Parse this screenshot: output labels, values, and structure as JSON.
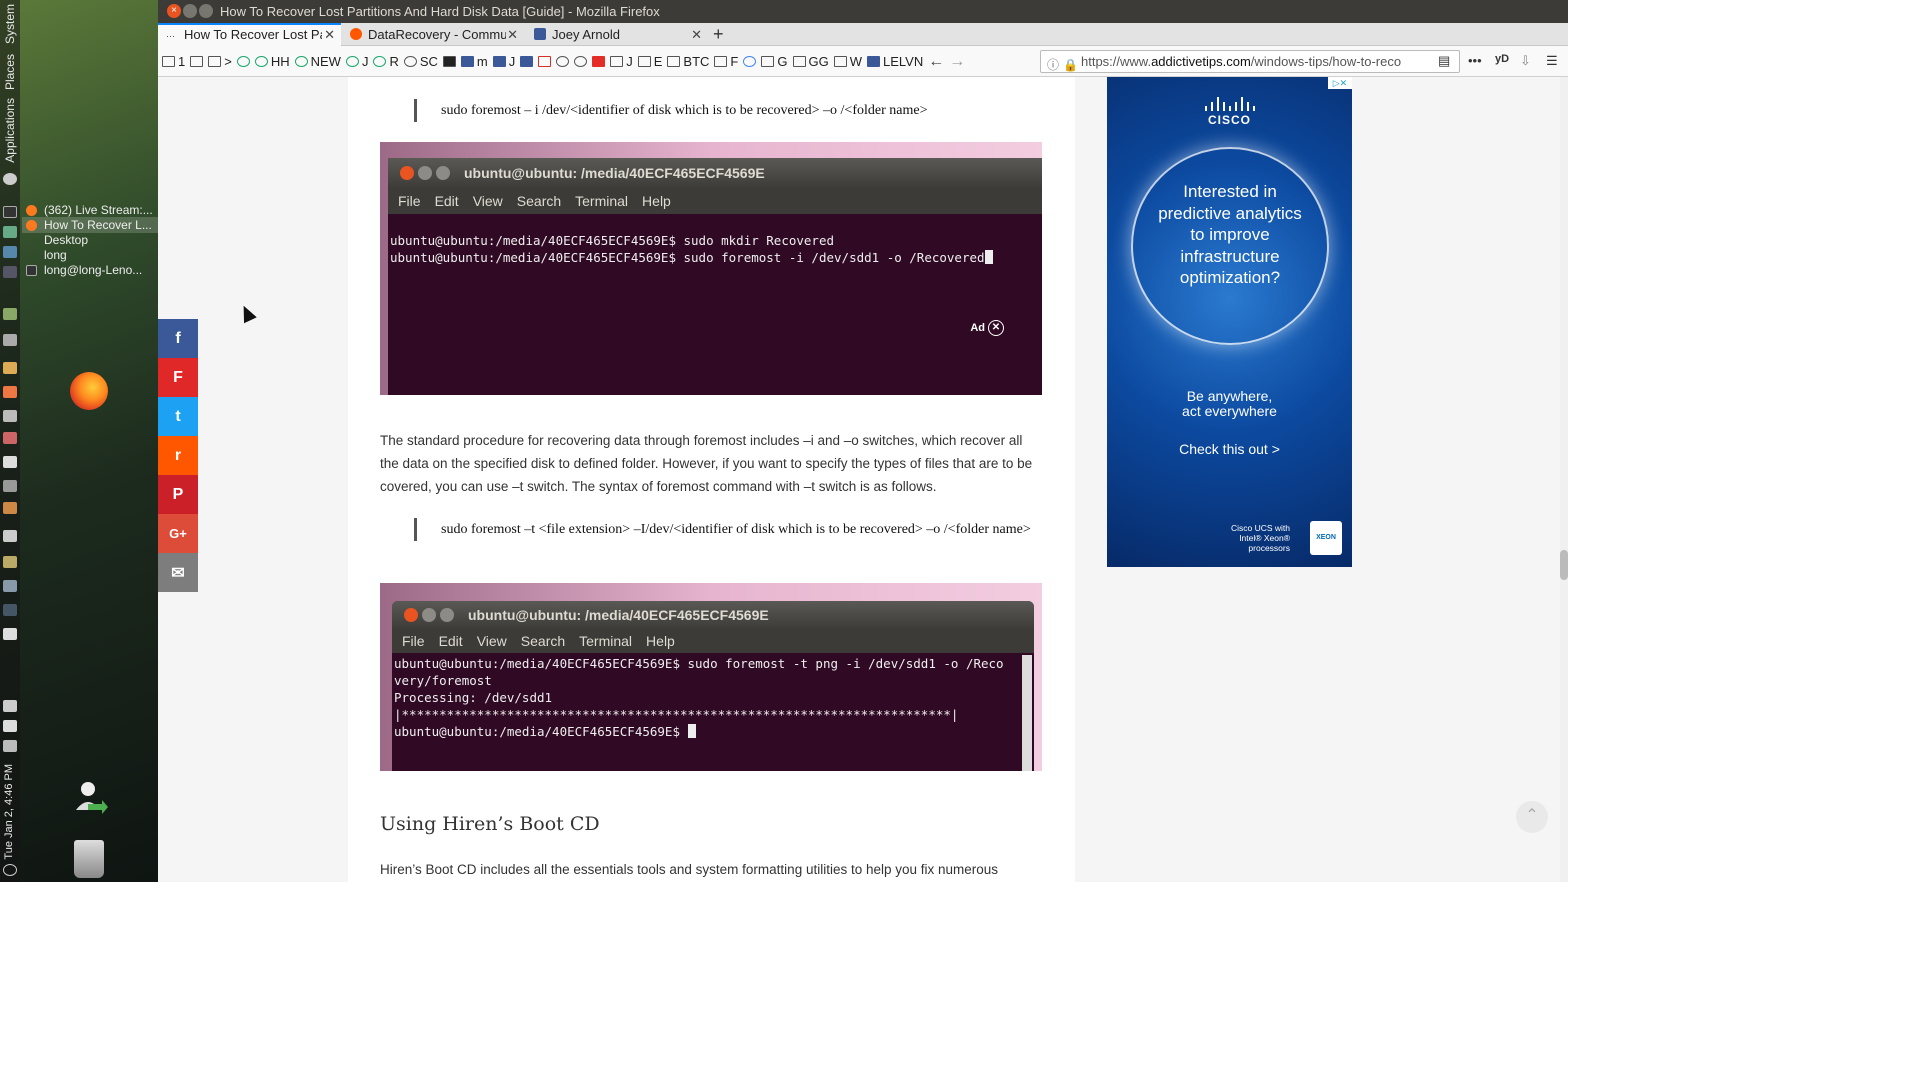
{
  "desktop": {
    "vertical_labels": [
      "System",
      "Places",
      "Applications"
    ],
    "clock": "Tue Jan 2, 4:46 PM",
    "window_list": [
      {
        "label": "(362) Live Stream:...",
        "active": false
      },
      {
        "label": "How To Recover L...",
        "active": true
      },
      {
        "label": "Desktop",
        "active": false
      },
      {
        "label": "long",
        "active": false
      },
      {
        "label": "long@long-Leno...",
        "active": false
      }
    ]
  },
  "browser": {
    "window_title": "How To Recover Lost Partitions And Hard Disk Data [Guide] - Mozilla Firefox",
    "tabs": [
      {
        "label": "How To Recover Lost Pa",
        "active": true
      },
      {
        "label": "DataRecovery - Commun",
        "active": false
      },
      {
        "label": "Joey Arnold",
        "active": false
      }
    ],
    "bookmarks": [
      "1",
      "",
      ">",
      "",
      "HH",
      "NEW",
      "J",
      "R",
      "SC",
      "",
      "m",
      "J",
      "",
      "",
      "",
      "",
      "",
      "J",
      "E",
      "BTC",
      "F",
      "",
      "G",
      "GG",
      "W",
      "LELVN"
    ],
    "url_prefix": "https://www.",
    "url_host": "addictivetips.com",
    "url_path": "/windows-tips/how-to-reco"
  },
  "article": {
    "quote1": "sudo foremost – i /dev/<identifier of disk which is to be recovered> –o /<folder name>",
    "terminal1": {
      "title": "ubuntu@ubuntu: /media/40ECF465ECF4569E",
      "menu": [
        "File",
        "Edit",
        "View",
        "Search",
        "Terminal",
        "Help"
      ],
      "line1": "ubuntu@ubuntu:/media/40ECF465ECF4569E$ sudo mkdir Recovered",
      "line2": "ubuntu@ubuntu:/media/40ECF465ECF4569E$ sudo foremost -i /dev/sdd1 -o /Recovered",
      "ad_label": "Ad"
    },
    "paragraph1": "The standard procedure for recovering data through foremost includes –i and –o switches, which recover all the data on the specified disk to defined folder. However, if you want to specify the types of files that are to be covered, you can use –t switch. The syntax of foremost command with –t switch is as follows.",
    "quote2": "sudo foremost –t <file extension> –I/dev/<identifier of disk which is to be recovered> –o /<folder name>",
    "terminal2": {
      "title": "ubuntu@ubuntu: /media/40ECF465ECF4569E",
      "menu": [
        "File",
        "Edit",
        "View",
        "Search",
        "Terminal",
        "Help"
      ],
      "line1": "ubuntu@ubuntu:/media/40ECF465ECF4569E$ sudo foremost -t png -i /dev/sdd1 -o /Reco",
      "line2": "very/foremost",
      "line3": "Processing: /dev/sdd1",
      "line4": "|*************************************************************************|",
      "line5": "ubuntu@ubuntu:/media/40ECF465ECF4569E$ "
    },
    "heading": "Using Hiren’s Boot CD",
    "paragraph2": "Hiren’s Boot CD includes all the essentials tools and system formatting utilities to help you fix numerous"
  },
  "share": [
    "f",
    "F",
    "t",
    "r",
    "P",
    "G+",
    "✉"
  ],
  "ad": {
    "brand": "CISCO",
    "headline": "Interested in predictive analytics to improve infrastructure optimization?",
    "sub1": "Be anywhere,",
    "sub2": "act everywhere",
    "cta": "Check this out >",
    "footer1": "Cisco UCS with",
    "footer2": "Intel® Xeon®",
    "footer3": "processors",
    "chip": "XEON"
  },
  "colors": {
    "facebook": "#3b5998",
    "flipboard": "#e12828",
    "twitter": "#1da1f2",
    "reddit": "#ff5700",
    "pinterest": "#cb2027",
    "googleplus": "#dd4b39",
    "email": "#7d7d7d"
  }
}
